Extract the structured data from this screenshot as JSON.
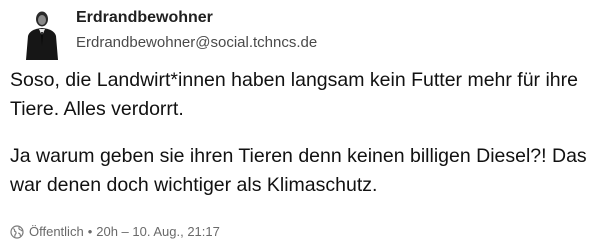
{
  "post": {
    "author": {
      "display_name": "Erdrandbewohner",
      "handle": "Erdrandbewohner@social.tchncs.de",
      "avatar_icon": "person-in-suit-avatar"
    },
    "content": {
      "paragraphs": [
        "Soso, die Landwirt*innen haben langsam kein Futter mehr für ihre Tiere. Alles verdorrt.",
        "Ja warum geben sie ihren Tieren denn keinen billigen Diesel?! Das war denen doch wichtiger als Klimaschutz."
      ]
    },
    "meta": {
      "visibility_icon": "globe-icon",
      "visibility": "Öffentlich",
      "separator": "•",
      "timestamp": "20h – 10. Aug., 21:17"
    }
  }
}
